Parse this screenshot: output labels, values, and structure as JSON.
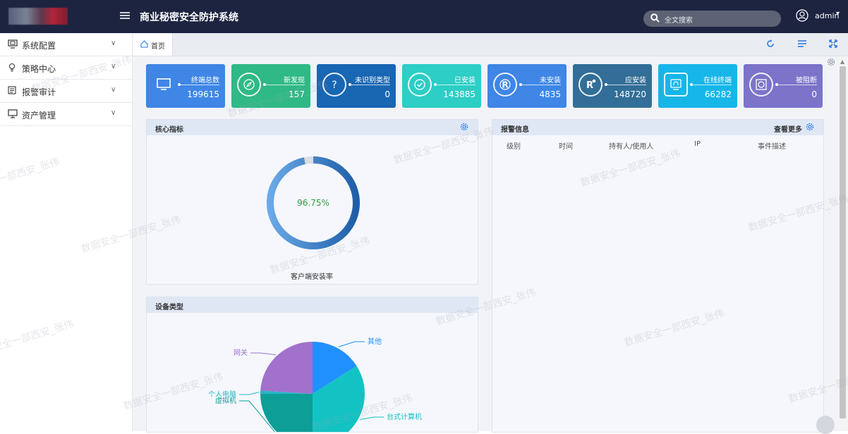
{
  "header": {
    "app_title": "商业秘密安全防护系统",
    "search_placeholder": "全文搜索",
    "username": "admin",
    "user_caret": "▾"
  },
  "sidebar": {
    "items": [
      {
        "label": "系统配置",
        "icon": "monitor-settings-icon"
      },
      {
        "label": "策略中心",
        "icon": "lightbulb-icon"
      },
      {
        "label": "报警审计",
        "icon": "list-audit-icon"
      },
      {
        "label": "资产管理",
        "icon": "computer-icon"
      }
    ],
    "chevron": "∨"
  },
  "tabs": {
    "home_label": "首页"
  },
  "stats": [
    {
      "label": "终端总数",
      "value": "199615",
      "color": "#3f86e6",
      "icon": "monitor-icon"
    },
    {
      "label": "新发现",
      "value": "157",
      "color": "#2fb986",
      "icon": "compass-icon"
    },
    {
      "label": "未识别类型",
      "value": "0",
      "color": "#1966b3",
      "icon": "question-icon"
    },
    {
      "label": "已安装",
      "value": "143885",
      "color": "#2ccec5",
      "icon": "check-icon"
    },
    {
      "label": "未安装",
      "value": "4835",
      "color": "#3f86e6",
      "icon": "registered-icon"
    },
    {
      "label": "应安装",
      "value": "148720",
      "color": "#326e97",
      "icon": "registered-dot-icon"
    },
    {
      "label": "在线终端",
      "value": "66282",
      "color": "#17b6e8",
      "icon": "headset-icon"
    },
    {
      "label": "被阻断",
      "value": "0",
      "color": "#7b74c9",
      "icon": "blocked-icon"
    }
  ],
  "core_panel": {
    "title": "核心指标",
    "percent_label": "96.75%",
    "percent": 96.75,
    "caption": "客户端安装率"
  },
  "alarm_panel": {
    "title": "报警信息",
    "more_label": "查看更多",
    "columns": [
      "级别",
      "时间",
      "持有人/使用人",
      "IP",
      "事件描述"
    ]
  },
  "device_panel": {
    "title": "设备类型"
  },
  "chart_data": {
    "type": "pie",
    "title": "设备类型",
    "slices": [
      {
        "label": "其他",
        "value": 16,
        "color": "#2190ff"
      },
      {
        "label": "台式计算机",
        "value": 34,
        "color": "#13c3c3"
      },
      {
        "label": "虚拟机",
        "value": 25,
        "color": "#0d9e98"
      },
      {
        "label": "个人电脑",
        "value": 1,
        "color": "#29b6c5"
      },
      {
        "label": "网关",
        "value": 24,
        "color": "#a171cc"
      }
    ]
  },
  "watermark_text": "数据安全一部西安_张伟",
  "colors": {
    "header_bg": "#1c2440",
    "accent": "#3f86e6"
  }
}
